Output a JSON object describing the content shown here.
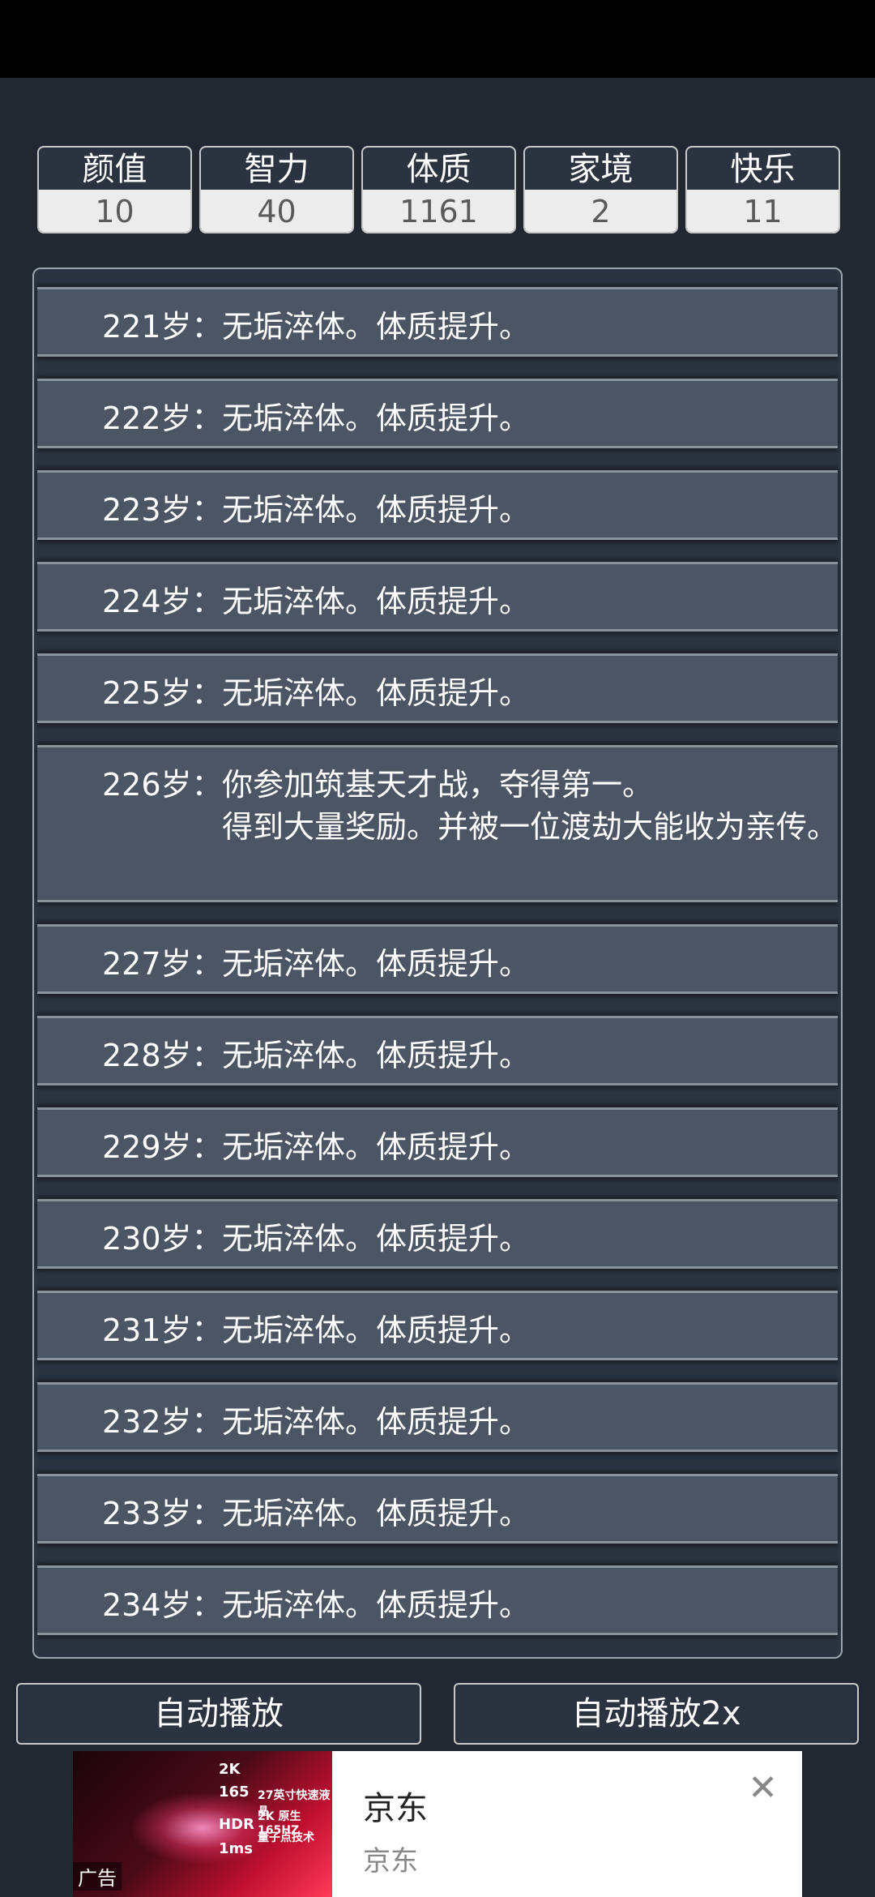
{
  "stats": [
    {
      "label": "颜值",
      "value": "10"
    },
    {
      "label": "智力",
      "value": "40"
    },
    {
      "label": "体质",
      "value": "1161"
    },
    {
      "label": "家境",
      "value": "2"
    },
    {
      "label": "快乐",
      "value": "11"
    }
  ],
  "log": [
    {
      "age": "221岁：",
      "text": "无垢淬体。体质提升。"
    },
    {
      "age": "222岁：",
      "text": "无垢淬体。体质提升。"
    },
    {
      "age": "223岁：",
      "text": "无垢淬体。体质提升。"
    },
    {
      "age": "224岁：",
      "text": "无垢淬体。体质提升。"
    },
    {
      "age": "225岁：",
      "text": "无垢淬体。体质提升。"
    },
    {
      "age": "226岁：",
      "text": "你参加筑基天才战，夺得第一。",
      "text2": "得到大量奖励。并被一位渡劫大能收为亲传。"
    },
    {
      "age": "227岁：",
      "text": "无垢淬体。体质提升。"
    },
    {
      "age": "228岁：",
      "text": "无垢淬体。体质提升。"
    },
    {
      "age": "229岁：",
      "text": "无垢淬体。体质提升。"
    },
    {
      "age": "230岁：",
      "text": "无垢淬体。体质提升。"
    },
    {
      "age": "231岁：",
      "text": "无垢淬体。体质提升。"
    },
    {
      "age": "232岁：",
      "text": "无垢淬体。体质提升。"
    },
    {
      "age": "233岁：",
      "text": "无垢淬体。体质提升。"
    },
    {
      "age": "234岁：",
      "text": "无垢淬体。体质提升。"
    }
  ],
  "buttons": {
    "auto_play": "自动播放",
    "auto_play_2x": "自动播放2x"
  },
  "ad": {
    "title": "京东",
    "subtitle": "京东",
    "tag": "广告",
    "close_icon": "close-icon",
    "image_specs": [
      "2K",
      "165",
      "HDR",
      "1ms",
      "27英寸快速液晶",
      "2K 原生165HZ",
      "量子点技术"
    ]
  }
}
